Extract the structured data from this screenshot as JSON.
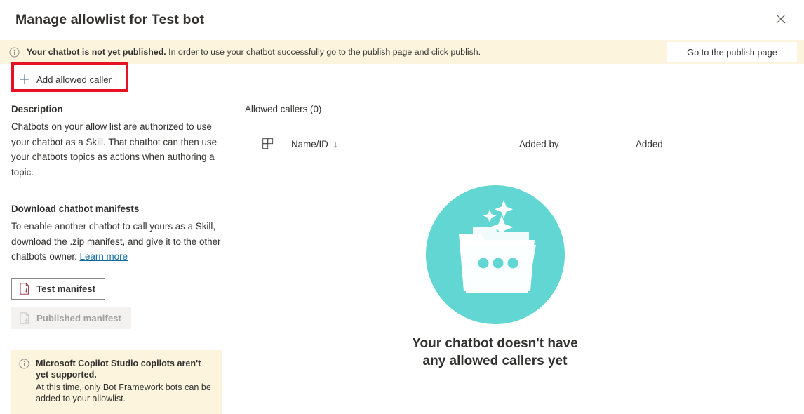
{
  "header": {
    "title": "Manage allowlist for Test bot",
    "close_icon": "close-icon"
  },
  "publish_banner": {
    "icon": "info-circle-icon",
    "bold_text": "Your chatbot is not yet published.",
    "rest_text": " In order to use your chatbot successfully go to the publish page and click publish.",
    "button_label": "Go to the publish page",
    "background_color": "#fdf4dd"
  },
  "command_bar": {
    "add_caller_label": "Add allowed caller",
    "add_icon": "plus-icon",
    "highlight_color": "#e81123"
  },
  "left_panel": {
    "description_heading": "Description",
    "description_body": "Chatbots on your allow list are authorized to use your chatbot as a Skill. That chatbot can then use your chatbots topics as actions when authoring a topic.",
    "manifests_heading": "Download chatbot manifests",
    "manifests_body": "To enable another chatbot to call yours as a Skill, download the .zip manifest, and give it to the other chatbots owner. ",
    "learn_more_label": "Learn more",
    "test_manifest_label": "Test manifest",
    "published_manifest_label": "Published manifest",
    "manifest_icon": "document-download-icon",
    "note": {
      "icon": "info-circle-icon",
      "title": "Microsoft Copilot Studio copilots aren't yet supported.",
      "body": "At this time, only Bot Framework bots can be added to your allowlist.",
      "background_color": "#fdf4dd"
    }
  },
  "right_panel": {
    "list_title": "Allowed callers (0)",
    "table": {
      "grid_icon": "table-layout-icon",
      "columns": [
        {
          "label": "",
          "key": "icon"
        },
        {
          "label": "Name/ID",
          "key": "name",
          "sorted": true,
          "sort_arrow": "↓"
        },
        {
          "label": "Added by",
          "key": "added_by"
        },
        {
          "label": "Added",
          "key": "added"
        }
      ],
      "rows": []
    },
    "empty_state": {
      "illustration": "empty-folder-sparkles-illustration",
      "illustration_color": "#62d6d2",
      "message": "Your chatbot doesn't have any allowed callers yet"
    }
  }
}
